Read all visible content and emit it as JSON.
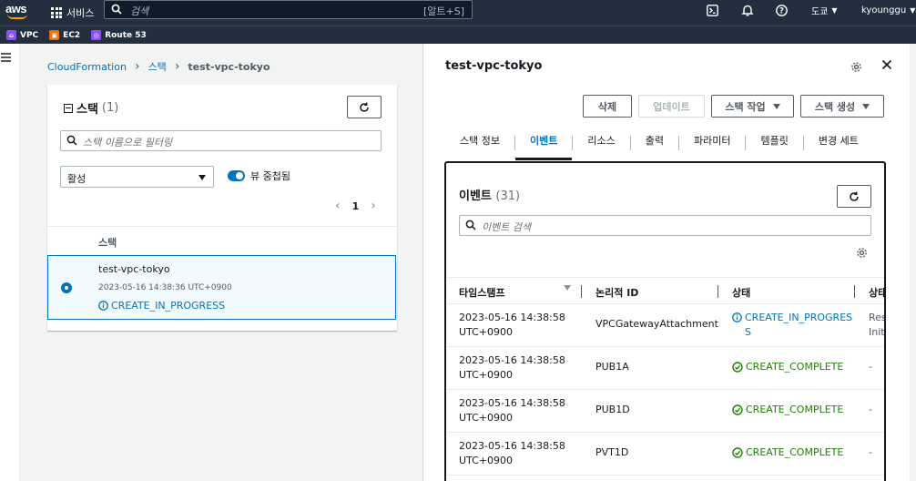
{
  "topnav": {
    "logo": "aws",
    "services_label": "서비스",
    "search_placeholder": "검색",
    "search_shortcut": "[알트+S]",
    "region": "도쿄",
    "user": "kyounggu"
  },
  "favorites": [
    {
      "label": "VPC",
      "color": "#8c4fff"
    },
    {
      "label": "EC2",
      "color": "#ed7100"
    },
    {
      "label": "Route 53",
      "color": "#8c4fff"
    }
  ],
  "breadcrumb": {
    "root": "CloudFormation",
    "stacks": "스택",
    "current": "test-vpc-tokyo"
  },
  "stacks_panel": {
    "title": "스택",
    "count": "(1)",
    "filter_placeholder": "스택 이름으로 필터링",
    "status_filter": "활성",
    "toggle_label": "뷰 중첩됨",
    "page": "1",
    "column_header": "스택",
    "rows": [
      {
        "name": "test-vpc-tokyo",
        "time": "2023-05-16 14:38:36 UTC+0900",
        "status": "CREATE_IN_PROGRESS"
      }
    ]
  },
  "detail": {
    "title": "test-vpc-tokyo",
    "buttons": {
      "delete": "삭제",
      "update": "업데이트",
      "stack_actions": "스택 작업",
      "create_stack": "스택 생성"
    },
    "tabs": [
      "스택 정보",
      "이벤트",
      "리소스",
      "출력",
      "파라미터",
      "템플릿",
      "변경 세트"
    ],
    "active_tab": "이벤트"
  },
  "events": {
    "title": "이벤트",
    "count": "(31)",
    "search_placeholder": "이벤트 검색",
    "columns": [
      "타임스탬프",
      "논리적 ID",
      "상태",
      "상태"
    ],
    "rows": [
      {
        "ts1": "2023-05-16 14:38:58",
        "ts2": "UTC+0900",
        "id": "VPCGatewayAttachment",
        "status1": "CREATE_IN_PROGRES",
        "status2": "S",
        "kind": "progress",
        "reason1": "Reso",
        "reason2": "Initi"
      },
      {
        "ts1": "2023-05-16 14:38:58",
        "ts2": "UTC+0900",
        "id": "PUB1A",
        "status1": "CREATE_COMPLETE",
        "status2": "",
        "kind": "complete",
        "reason1": "-",
        "reason2": ""
      },
      {
        "ts1": "2023-05-16 14:38:58",
        "ts2": "UTC+0900",
        "id": "PUB1D",
        "status1": "CREATE_COMPLETE",
        "status2": "",
        "kind": "complete",
        "reason1": "-",
        "reason2": ""
      },
      {
        "ts1": "2023-05-16 14:38:58",
        "ts2": "UTC+0900",
        "id": "PVT1D",
        "status1": "CREATE_COMPLETE",
        "status2": "",
        "kind": "complete",
        "reason1": "-",
        "reason2": ""
      }
    ]
  },
  "colors": {
    "nav_bg": "#232f3e",
    "link": "#0073bb",
    "success": "#1d8102",
    "accent": "#ff9900"
  }
}
